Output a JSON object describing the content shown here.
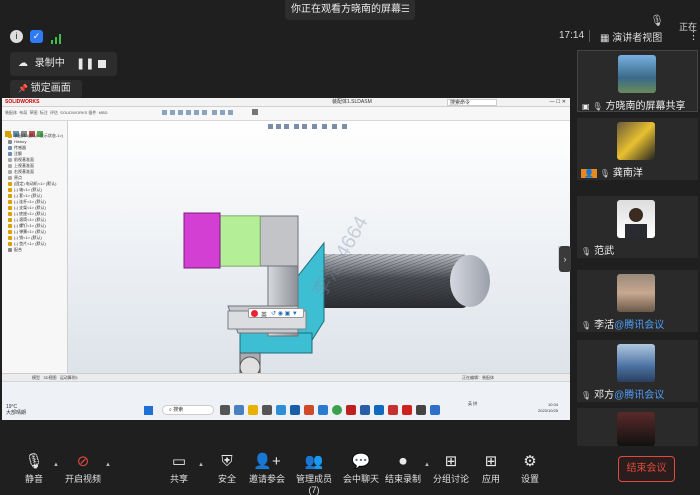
{
  "banner": {
    "text": "你正在观看方晓南的屏幕",
    "menu_icon": "menu-icon"
  },
  "topbar": {
    "time": "17:14",
    "view_label": "演讲者视图",
    "mic_label": "正在"
  },
  "recording": {
    "label": "录制中",
    "lock_label": "锁定画面"
  },
  "shared_screen": {
    "app_name": "SOLIDWORKS",
    "file_label": "装配体1.SLDASM",
    "search_placeholder": "搜索命令",
    "cmd_tabs": [
      "装配体",
      "布局",
      "草图",
      "标注",
      "评估",
      "SOLIDWORKS 插件",
      "MBD"
    ],
    "tree": [
      "装配体1(默认<显示状态-1>)",
      "History",
      "传感器",
      "注解",
      "前视基准面",
      "上视基准面",
      "右视基准面",
      "原点",
      "(固定) 电动机<1> (默认)",
      "(-) 轴<1> (默认)",
      "(-) 套<1> (默认)",
      "(-) 连杆<1> (默认)",
      "(-) 支架<1> (默认)",
      "(-) 底座<1> (默认)",
      "(-) 滚筒<1> (默认)",
      "(-) 螺钉<1> (默认)",
      "(-) 弹簧<1> (默认)",
      "(-) 销<1> (默认)",
      "(-) 垫片<1> (默认)",
      "配合"
    ],
    "status_tabs": [
      "模型",
      "3D视图",
      "运动算例1"
    ],
    "status_right": "正在编辑：装配体",
    "watermark": "李活 4664",
    "float_toolbar": "英",
    "taskbar": {
      "weather_temp": "19°C",
      "weather_desc": "大部晴朗",
      "search_label": "搜索",
      "lang": "英 拼",
      "clock_time": "10:04",
      "clock_date": "2023/10/25"
    }
  },
  "participants": [
    {
      "name": "方晓南的屏幕共享",
      "tag": "",
      "color": "#4a90c8"
    },
    {
      "name": "龚南洋",
      "tag": "",
      "color": "#c8a020"
    },
    {
      "name": "范武",
      "tag": "",
      "color": "#888888"
    },
    {
      "name": "李活",
      "tag": "@腾讯会议",
      "color": "#b08a6a"
    },
    {
      "name": "邓方",
      "tag": "@腾讯会议",
      "color": "#5a7a9a"
    },
    {
      "name": "",
      "tag": "",
      "color": "#3a2a2a"
    }
  ],
  "toolbar": {
    "mute": "静音",
    "video": "开启视频",
    "share": "共享",
    "security": "安全",
    "invite": "邀请参会",
    "members": "管理成员(7)",
    "chat": "会中聊天",
    "stop_record": "结束录制",
    "breakout": "分组讨论",
    "apps": "应用",
    "settings": "设置",
    "end": "结束会议"
  }
}
